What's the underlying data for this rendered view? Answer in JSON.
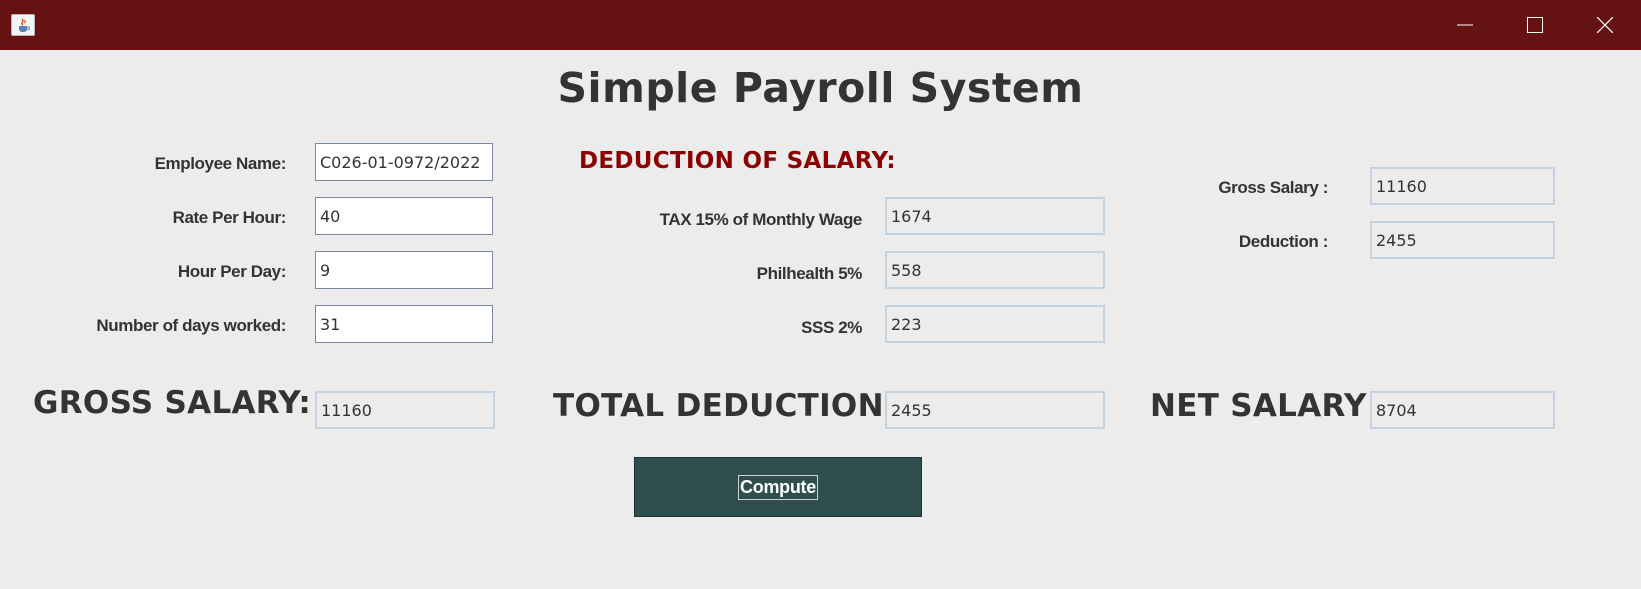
{
  "window": {
    "title": "",
    "minimize_glyph": "—",
    "maximize_glyph": "☐",
    "close_glyph": "✕",
    "titlebar_color": "#651213"
  },
  "heading": "Simple Payroll System",
  "inputs": {
    "employee_name_label": "Employee Name:",
    "employee_name_value": "C026-01-0972/2022",
    "rate_per_hour_label": "Rate Per Hour:",
    "rate_per_hour_value": "40",
    "hour_per_day_label": "Hour Per Day:",
    "hour_per_day_value": "9",
    "days_worked_label": "Number of days worked:",
    "days_worked_value": "31"
  },
  "deductions": {
    "section_title": "DEDUCTION OF SALARY:",
    "tax_label": "TAX  15% of Monthly Wage",
    "tax_value": "1674",
    "philhealth_label": "Philhealth 5%",
    "philhealth_value": "558",
    "sss_label": "SSS 2%",
    "sss_value": "223"
  },
  "summary": {
    "gross_salary_label": "Gross Salary :",
    "gross_salary_value": "11160",
    "deduction_label": "Deduction :",
    "deduction_value": "2455"
  },
  "totals": {
    "gross_label": "GROSS SALARY:",
    "gross_value": "11160",
    "total_deduction_label": "TOTAL DEDUCTION :",
    "total_deduction_value": "2455",
    "net_label": "NET SALARY :",
    "net_value": "8704"
  },
  "compute_button": "Compute",
  "colors": {
    "background": "#ececec",
    "section_title": "#8b0000",
    "compute_button": "#2f4f4f"
  },
  "icons": {
    "app_icon": "java-coffee-cup-icon"
  }
}
